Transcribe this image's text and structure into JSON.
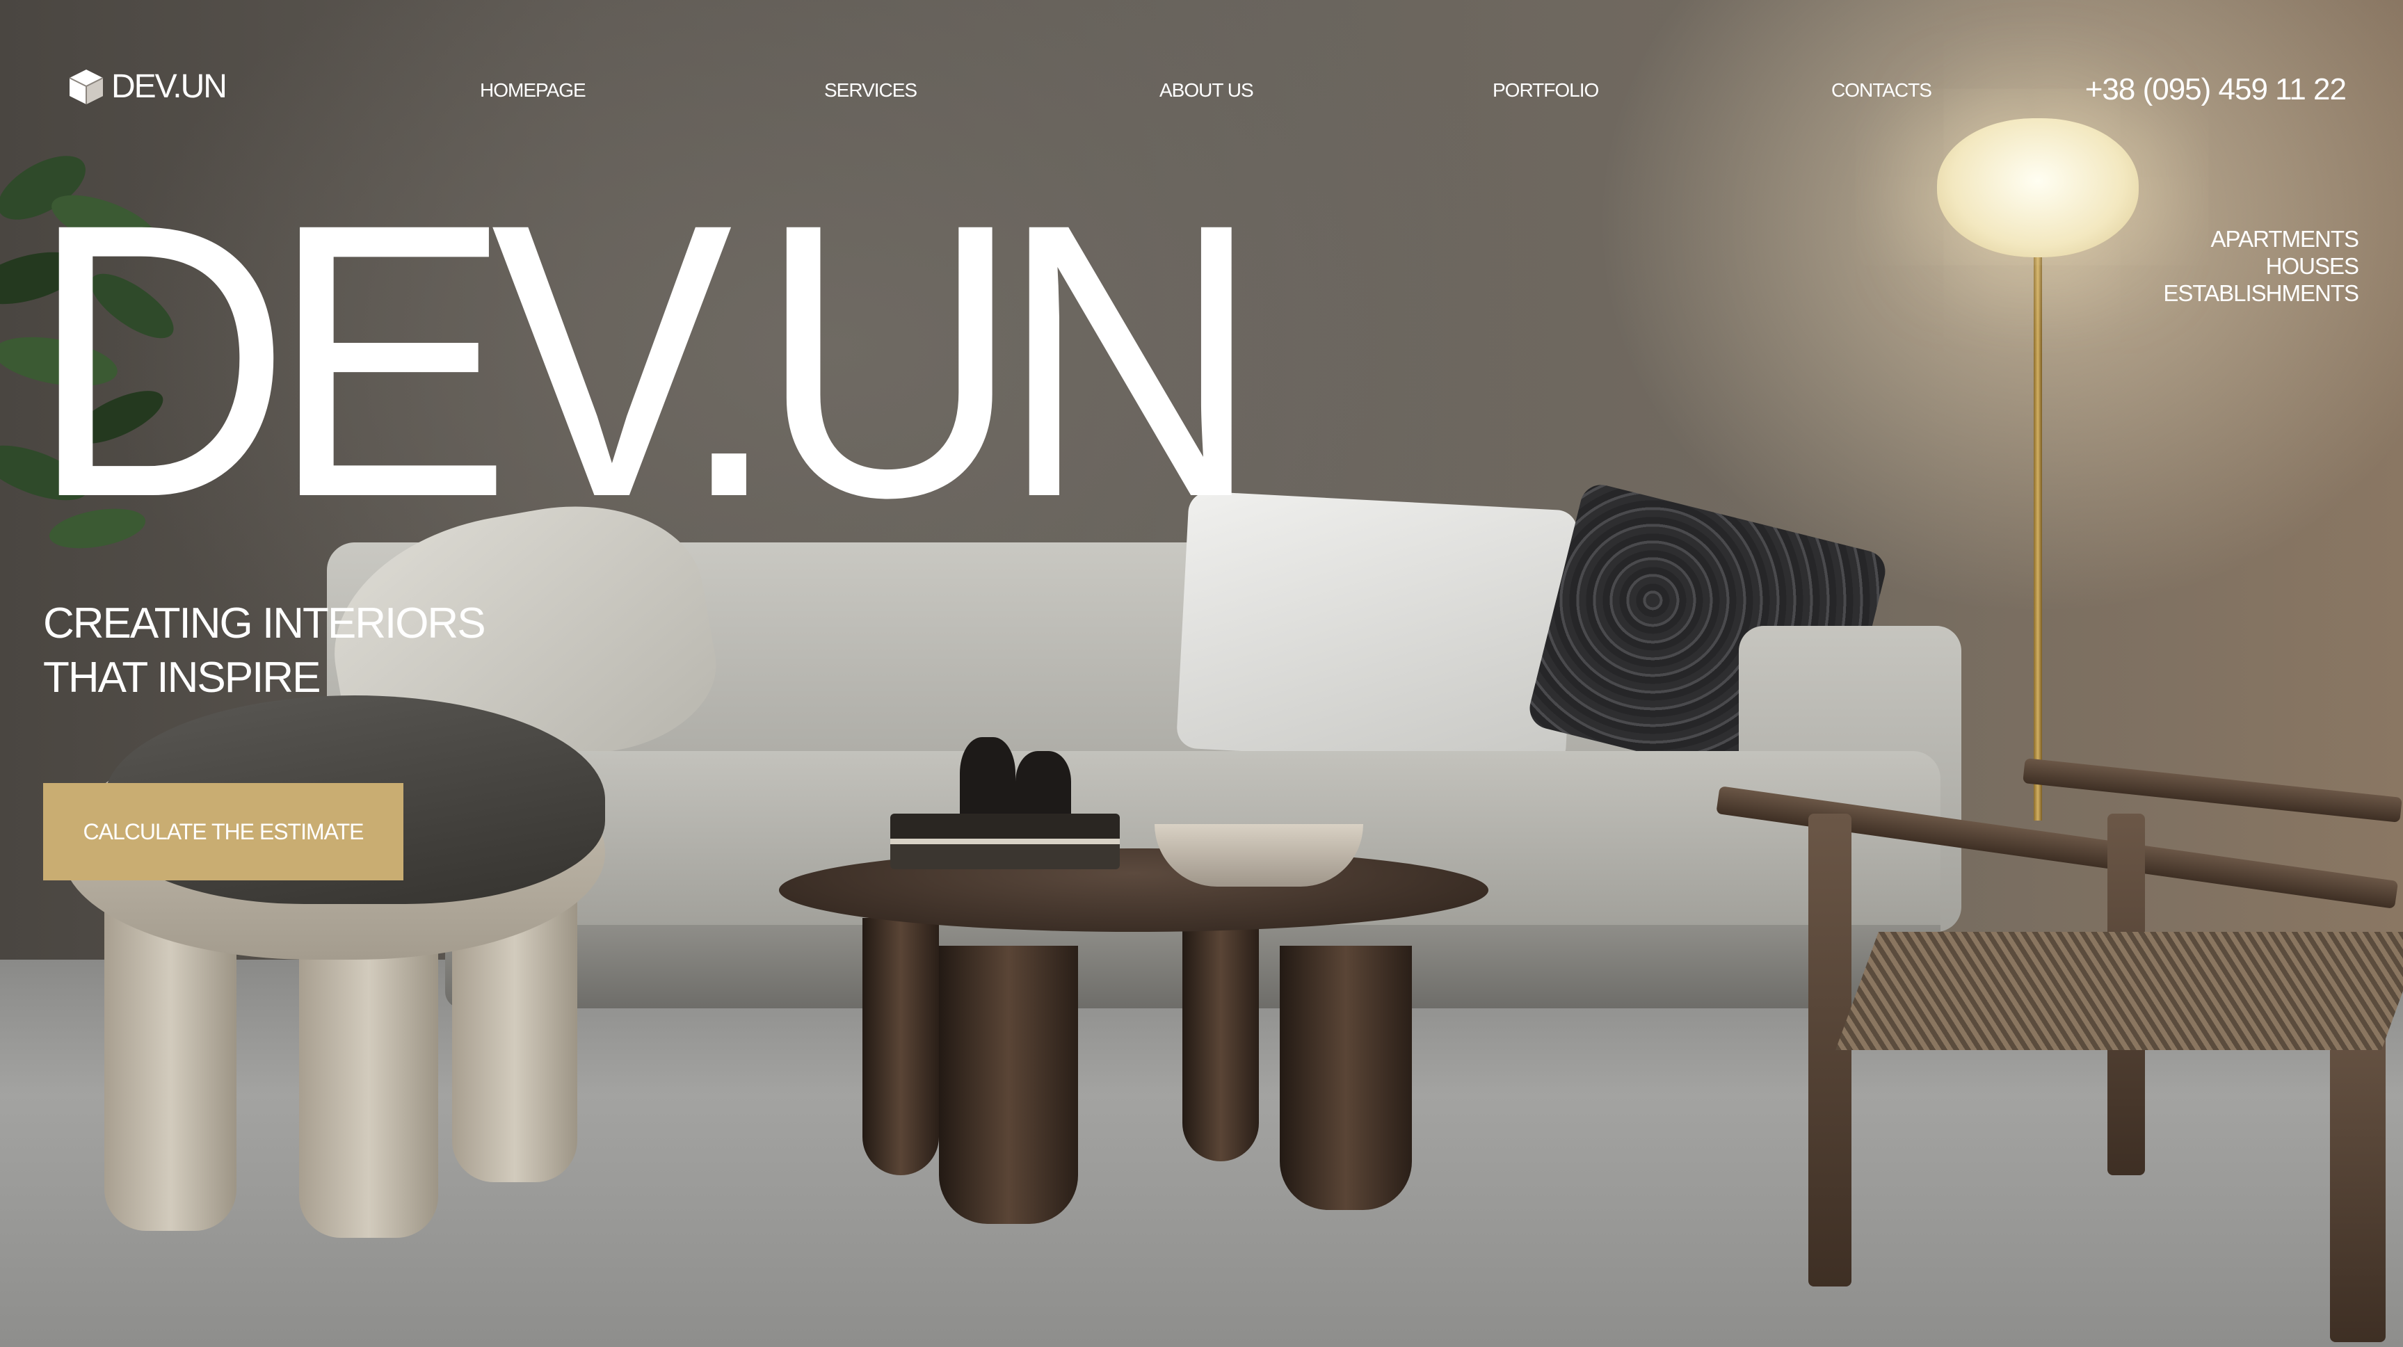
{
  "brand": {
    "logo_text": "DEV.UN",
    "logo_icon": "cube-icon"
  },
  "nav": {
    "items": [
      {
        "label": "HOMEPAGE"
      },
      {
        "label": "SERVICES"
      },
      {
        "label": "ABOUT US"
      },
      {
        "label": "PORTFOLIO"
      },
      {
        "label": "CONTACTS"
      }
    ]
  },
  "phone": "+38 (095) 459 11 22",
  "hero": {
    "title": "DEV.UN",
    "tagline_line1": "CREATING INTERIORS",
    "tagline_line2": "THAT INSPIRE",
    "cta_label": "CALCULATE THE ESTIMATE"
  },
  "categories": [
    "APARTMENTS",
    "HOUSES",
    "ESTABLISHMENTS"
  ],
  "colors": {
    "accent": "#c9ad72",
    "text": "#ffffff"
  }
}
